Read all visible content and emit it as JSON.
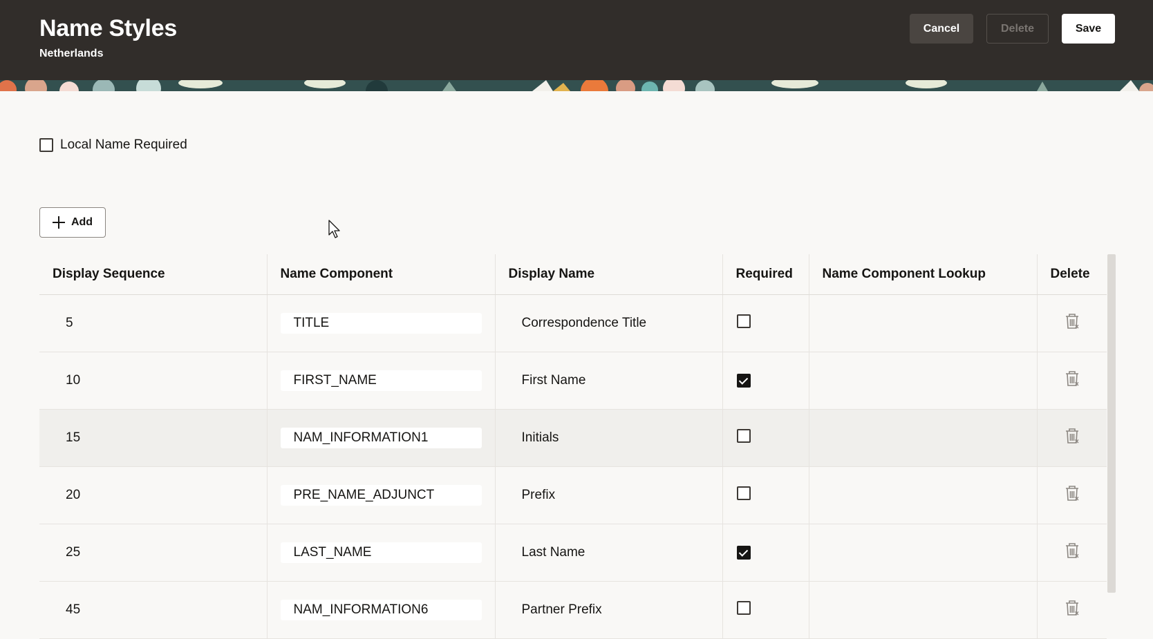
{
  "header": {
    "title": "Name Styles",
    "subtitle": "Netherlands",
    "cancel_label": "Cancel",
    "delete_label": "Delete",
    "save_label": "Save",
    "background_color": "#312d2a"
  },
  "options": {
    "local_name_required_label": "Local Name Required",
    "local_name_required_checked": false
  },
  "toolbar": {
    "add_label": "Add"
  },
  "table": {
    "columns": [
      "Display Sequence",
      "Name Component",
      "Display Name",
      "Required",
      "Name Component Lookup",
      "Delete"
    ],
    "rows": [
      {
        "sequence": "5",
        "component": "TITLE",
        "display_name": "Correspondence Title",
        "required": false,
        "lookup": ""
      },
      {
        "sequence": "10",
        "component": "FIRST_NAME",
        "display_name": "First Name",
        "required": true,
        "lookup": ""
      },
      {
        "sequence": "15",
        "component": "NAM_INFORMATION1",
        "display_name": "Initials",
        "required": false,
        "lookup": ""
      },
      {
        "sequence": "20",
        "component": "PRE_NAME_ADJUNCT",
        "display_name": "Prefix",
        "required": false,
        "lookup": ""
      },
      {
        "sequence": "25",
        "component": "LAST_NAME",
        "display_name": "Last Name",
        "required": true,
        "lookup": ""
      },
      {
        "sequence": "45",
        "component": "NAM_INFORMATION6",
        "display_name": "Partner Prefix",
        "required": false,
        "lookup": ""
      }
    ]
  },
  "icons": {
    "add": "plus-icon",
    "delete_row": "trash-icon",
    "pointer": "mouse-cursor-icon"
  }
}
